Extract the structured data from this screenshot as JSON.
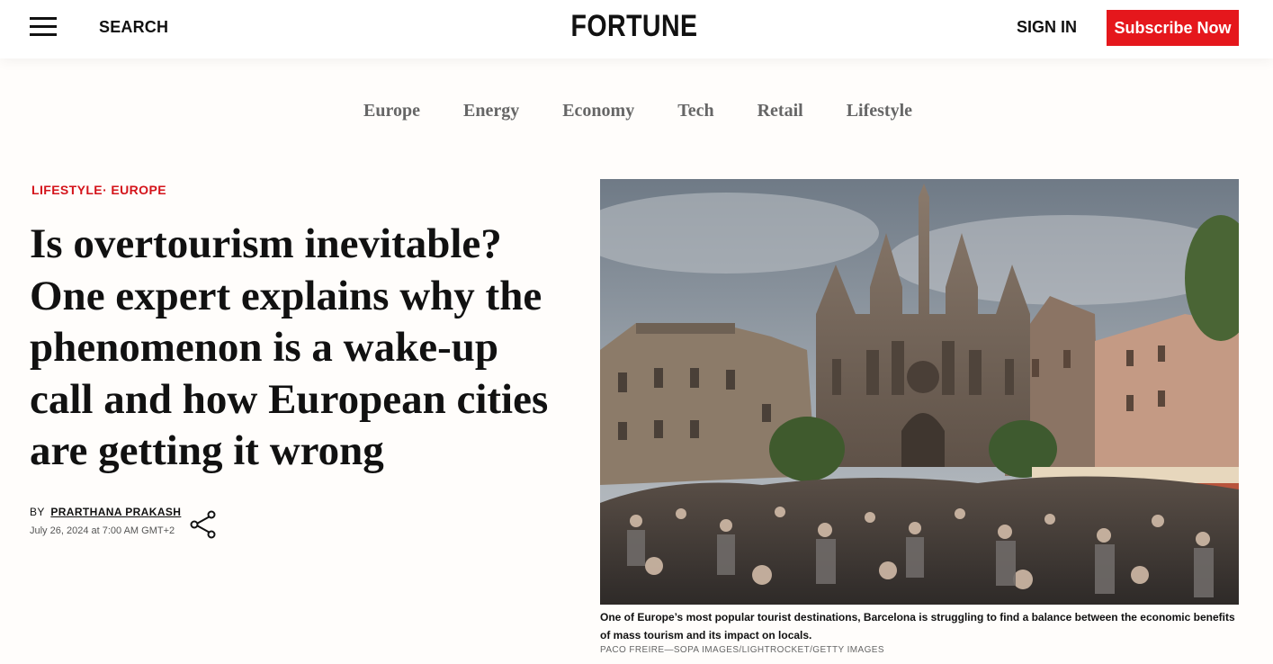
{
  "header": {
    "search_label": "SEARCH",
    "logo_text": "FORTUNE",
    "signin_label": "SIGN IN",
    "subscribe_label": "Subscribe Now",
    "subscribe_color": "#e5171c"
  },
  "category_nav": [
    "Europe",
    "Energy",
    "Economy",
    "Tech",
    "Retail",
    "Lifestyle"
  ],
  "article": {
    "section_primary": "LIFESTYLE",
    "section_separator": "·",
    "section_secondary": "EUROPE",
    "headline": "Is overtourism inevitable? One expert explains why the phenomenon is a wake-up call and how European cities are getting it wrong",
    "by_label": "BY",
    "author": "PRARTHANA PRAKASH",
    "date": "July 26, 2024 at 7:00 AM GMT+2",
    "image_caption": "One of Europe’s most popular tourist destinations, Barcelona is struggling to find a balance between the economic benefits of mass tourism and its impact on locals.",
    "image_credit": "PACO FREIRE—SOPA IMAGES/LIGHTROCKET/GETTY IMAGES"
  },
  "icons": {
    "menu": "hamburger-menu-icon",
    "share": "share-icon"
  },
  "colors": {
    "accent_red": "#d4141b",
    "nav_gray": "#666666"
  }
}
